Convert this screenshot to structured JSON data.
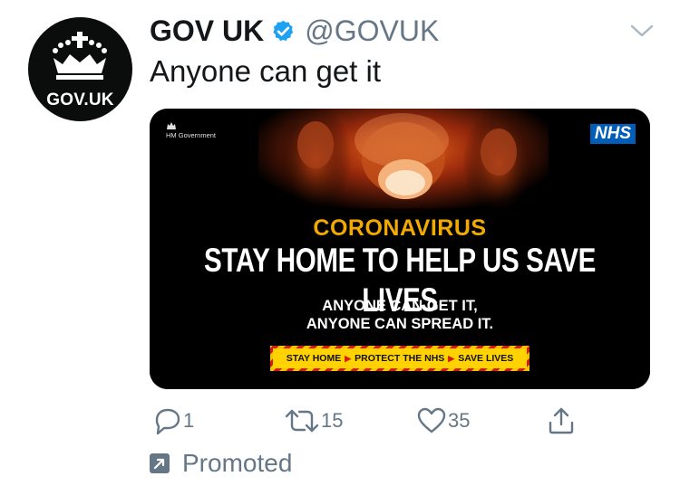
{
  "account": {
    "avatar_text": "GOV.UK",
    "name": "GOV UK",
    "handle": "@GOVUK"
  },
  "tweet": {
    "text": "Anyone can get it"
  },
  "media": {
    "hm_government": "HM Government",
    "nhs_logo": "NHS",
    "kicker": "CORONAVIRUS",
    "headline": "STAY HOME TO HELP US SAVE LIVES",
    "line1": "ANYONE CAN GET IT,",
    "line2": "ANYONE CAN SPREAD IT.",
    "banner": [
      "STAY HOME",
      "PROTECT THE NHS",
      "SAVE LIVES"
    ]
  },
  "actions": {
    "replies": "1",
    "retweets": "15",
    "likes": "35"
  },
  "promoted_label": "Promoted",
  "colors": {
    "verified": "#1da1f2",
    "muted_text": "#657786",
    "nhs_blue": "#005eb8",
    "corona_yellow": "#f2a900"
  },
  "icons": [
    "crown-icon",
    "verified-badge-icon",
    "chevron-down-icon",
    "reply-icon",
    "retweet-icon",
    "like-icon",
    "share-icon",
    "promoted-icon"
  ]
}
